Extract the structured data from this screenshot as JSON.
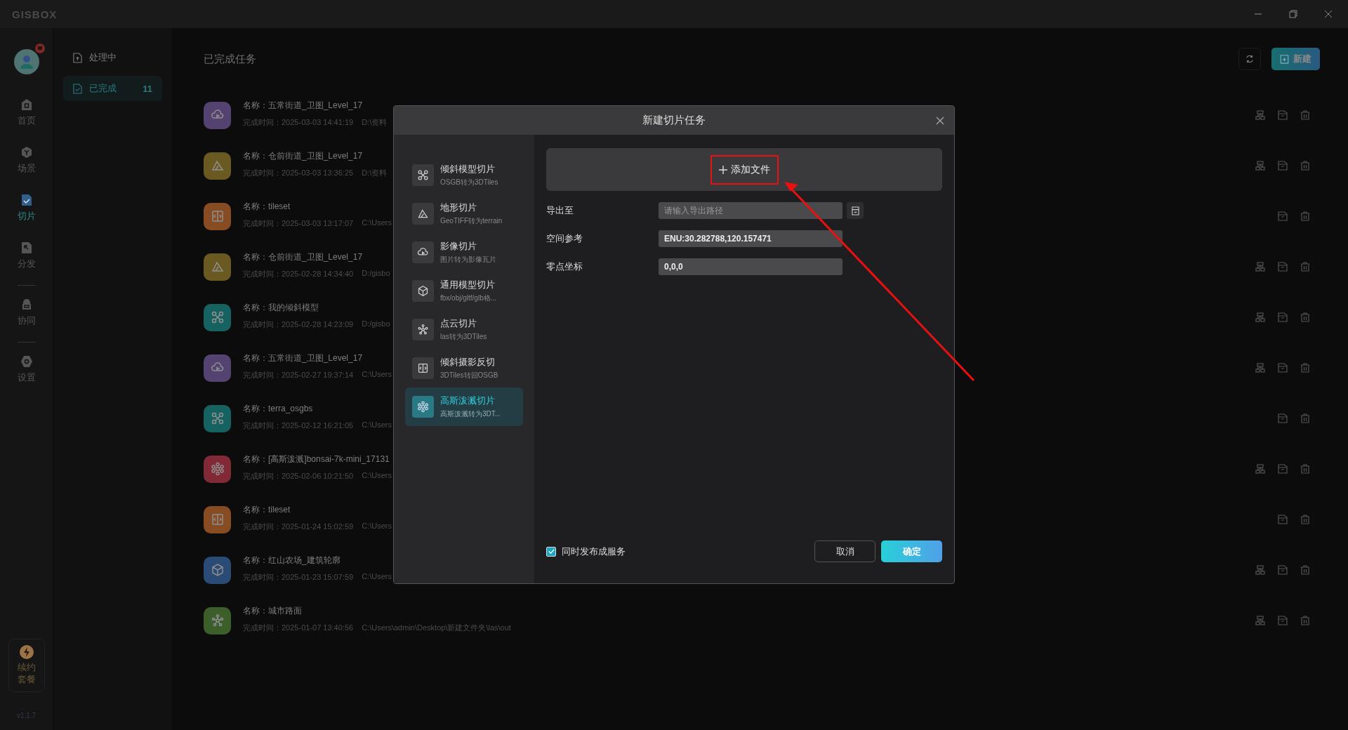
{
  "app": {
    "logo": "GISBOX",
    "version": "v1.1.7",
    "renew": "续约套餐"
  },
  "nav": [
    {
      "label": "首页",
      "kind": "home",
      "selected": false
    },
    {
      "label": "场景",
      "kind": "scene",
      "selected": false
    },
    {
      "label": "切片",
      "kind": "tile",
      "selected": true
    },
    {
      "label": "分发",
      "kind": "share",
      "selected": false
    },
    {
      "label": "协同",
      "kind": "lock",
      "selected": false
    },
    {
      "label": "设置",
      "kind": "settings",
      "selected": false
    }
  ],
  "task_tabs": [
    {
      "label": "处理中",
      "selected": false
    },
    {
      "label": "已完成",
      "count": "11",
      "selected": true
    }
  ],
  "main": {
    "title": "已完成任务",
    "new_button": "新建"
  },
  "tasks": [
    {
      "name": "名称：五常街道_卫图_Level_17",
      "time": "完成时间：2025-03-03 14:41:19",
      "path": "D:\\资料",
      "kind": "imagery",
      "publish": true
    },
    {
      "name": "名称：仓前街道_卫图_Level_17",
      "time": "完成时间：2025-03-03 13:36:25",
      "path": "D:\\资料",
      "kind": "terrain",
      "publish": true
    },
    {
      "name": "名称：tileset",
      "time": "完成时间：2025-03-03 13:17:07",
      "path": "C:\\Users",
      "kind": "reverse",
      "publish": false
    },
    {
      "name": "名称：仓前街道_卫图_Level_17",
      "time": "完成时间：2025-02-28 14:34:40",
      "path": "D:/gisbo",
      "kind": "terrain",
      "publish": true
    },
    {
      "name": "名称：我的倾斜模型",
      "time": "完成时间：2025-02-28 14:23:09",
      "path": "D:/gisbo",
      "kind": "oblique",
      "publish": true
    },
    {
      "name": "名称：五常街道_卫图_Level_17",
      "time": "完成时间：2025-02-27 19:37:14",
      "path": "C:\\Users",
      "kind": "imagery",
      "publish": true
    },
    {
      "name": "名称：terra_osgbs",
      "time": "完成时间：2025-02-12 16:21:05",
      "path": "C:\\Users",
      "kind": "oblique",
      "publish": false
    },
    {
      "name": "名称：[高斯泼溅]bonsai-7k-mini_17131",
      "time": "完成时间：2025-02-06 10:21:50",
      "path": "C:\\Users",
      "kind": "splat",
      "publish": true
    },
    {
      "name": "名称：tileset",
      "time": "完成时间：2025-01-24 15:02:59",
      "path": "C:\\Users",
      "kind": "reverse",
      "publish": false
    },
    {
      "name": "名称：红山农场_建筑轮廓",
      "time": "完成时间：2025-01-23 15:07:59",
      "path": "C:\\Users",
      "kind": "model",
      "publish": true
    },
    {
      "name": "名称：城市路面",
      "time": "完成时间：2025-01-07 13:40:56",
      "path": "C:\\Users\\admin\\Desktop\\新建文件夹\\las\\out",
      "kind": "points",
      "publish": true
    }
  ],
  "dialog": {
    "title": "新建切片任务",
    "types": [
      {
        "title": "倾斜模型切片",
        "subtitle": "OSGB转为3DTiles",
        "kind": "oblique",
        "selected": false
      },
      {
        "title": "地形切片",
        "subtitle": "GeoTIFF转为terrain",
        "kind": "terrain",
        "selected": false
      },
      {
        "title": "影像切片",
        "subtitle": "图片转为影像瓦片",
        "kind": "imagery",
        "selected": false
      },
      {
        "title": "通用模型切片",
        "subtitle": "fbx/obj/gltf/glb格...",
        "kind": "model",
        "selected": false
      },
      {
        "title": "点云切片",
        "subtitle": "las转为3DTiles",
        "kind": "points",
        "selected": false
      },
      {
        "title": "倾斜摄影反切",
        "subtitle": "3DTiles转回OSGB",
        "kind": "reverse",
        "selected": false
      },
      {
        "title": "高斯泼溅切片",
        "subtitle": "高斯泼溅转为3DT...",
        "kind": "splat",
        "selected": true
      }
    ],
    "add_file": "添加文件",
    "fields": [
      {
        "label": "导出至",
        "placeholder": "请输入导出路径",
        "browse": true
      },
      {
        "label": "空间参考",
        "value": "ENU:30.282788,120.157471"
      },
      {
        "label": "零点坐标",
        "value": "0,0,0"
      }
    ],
    "publish": {
      "label": "同时发布成服务",
      "checked": true
    },
    "cancel": "取消",
    "confirm": "确定"
  }
}
